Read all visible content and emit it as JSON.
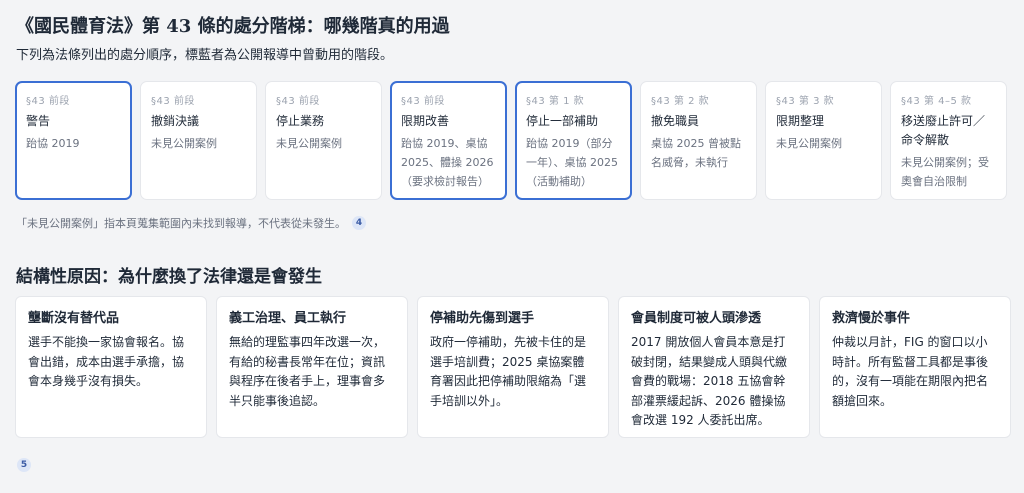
{
  "page": {
    "title": "《國民體育法》第 43 條的處分階梯：哪幾階真的用過",
    "subtitle": "下列為法條列出的處分順序，標藍者為公開報導中曾動用的階段。"
  },
  "steps": [
    {
      "tag": "§43 前段",
      "name": "警告",
      "note": "跆協 2019",
      "highlighted": true
    },
    {
      "tag": "§43 前段",
      "name": "撤銷決議",
      "note": "未見公開案例",
      "highlighted": false
    },
    {
      "tag": "§43 前段",
      "name": "停止業務",
      "note": "未見公開案例",
      "highlighted": false
    },
    {
      "tag": "§43 前段",
      "name": "限期改善",
      "note": "跆協 2019、桌協 2025、體操 2026（要求檢討報告）",
      "highlighted": true
    },
    {
      "tag": "§43 第 1 款",
      "name": "停止一部補助",
      "note": "跆協 2019（部分一年）、桌協 2025（活動補助）",
      "highlighted": true
    },
    {
      "tag": "§43 第 2 款",
      "name": "撤免職員",
      "note": "桌協 2025 曾被點名威脅，未執行",
      "highlighted": false
    },
    {
      "tag": "§43 第 3 款",
      "name": "限期整理",
      "note": "未見公開案例",
      "highlighted": false
    },
    {
      "tag": "§43 第 4–5 款",
      "name": "移送廢止許可／命令解散",
      "note": "未見公開案例；受奧會自治限制",
      "highlighted": false
    }
  ],
  "footnote": {
    "text": "「未見公開案例」指本頁蒐集範圍內未找到報導，不代表從未發生。",
    "badge": "4"
  },
  "section": {
    "title": "結構性原因：為什麼換了法律還是會發生"
  },
  "causes": [
    {
      "title": "壟斷沒有替代品",
      "body": "選手不能換一家協會報名。協會出錯，成本由選手承擔，協會本身幾乎沒有損失。"
    },
    {
      "title": "義工治理、員工執行",
      "body": "無給的理監事四年改選一次，有給的秘書長常年在位；資訊與程序在後者手上，理事會多半只能事後追認。"
    },
    {
      "title": "停補助先傷到選手",
      "body": "政府一停補助，先被卡住的是選手培訓費；2025 桌協案體育署因此把停補助限縮為「選手培訓以外」。"
    },
    {
      "title": "會員制度可被人頭滲透",
      "body": "2017 開放個人會員本意是打破封閉，結果變成人頭與代繳會費的戰場：2018 五協會幹部灌票緩起訴、2026 體操協會改選 192 人委託出席。"
    },
    {
      "title": "救濟慢於事件",
      "body": "仲裁以月計，FIG 的窗口以小時計。所有監督工具都是事後的，沒有一項能在期限內把名額搶回來。"
    }
  ],
  "bottom_badge": "5",
  "colors": {
    "accent": "#3b6fd4",
    "background": "#f3f4f6",
    "card": "#ffffff"
  }
}
